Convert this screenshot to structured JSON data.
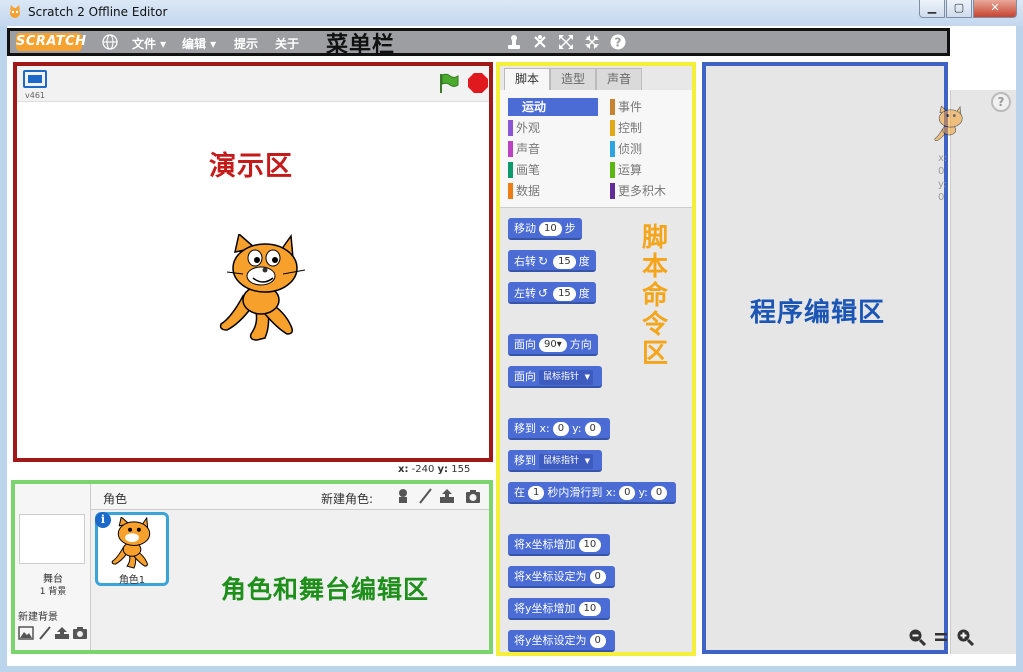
{
  "window": {
    "title": "Scratch 2 Offline Editor",
    "min_label": "▁",
    "max_label": "▢",
    "close_label": "✕"
  },
  "menubar": {
    "logo": "SCRATCH",
    "items": [
      "文件 ▾",
      "编辑 ▾",
      "提示",
      "关于"
    ],
    "annotation": "菜单栏"
  },
  "stage": {
    "version": "v461",
    "annotation": "演示区",
    "coords": {
      "x_label": "x:",
      "x": "-240",
      "y_label": "y:",
      "y": "155"
    }
  },
  "palette": {
    "tabs": [
      "脚本",
      "造型",
      "声音"
    ],
    "categories": [
      {
        "label": "运动",
        "color": "#4a6cd4"
      },
      {
        "label": "外观",
        "color": "#8a55d7"
      },
      {
        "label": "声音",
        "color": "#bb42c3"
      },
      {
        "label": "画笔",
        "color": "#0e9a6c"
      },
      {
        "label": "数据",
        "color": "#ee7d16"
      },
      {
        "label": "事件",
        "color": "#c88330"
      },
      {
        "label": "控制",
        "color": "#e1a91a"
      },
      {
        "label": "侦测",
        "color": "#2ca5e2"
      },
      {
        "label": "运算",
        "color": "#5cb712"
      },
      {
        "label": "更多积木",
        "color": "#632d99"
      }
    ],
    "annotation": "脚本命令区",
    "blocks": {
      "move": {
        "pre": "移动",
        "val": "10",
        "post": "步"
      },
      "turn_right": {
        "pre": "右转",
        "glyph": "↻",
        "val": "15",
        "post": "度"
      },
      "turn_left": {
        "pre": "左转",
        "glyph": "↺",
        "val": "15",
        "post": "度"
      },
      "point_dir": {
        "pre": "面向",
        "val": "90▾",
        "post": "方向"
      },
      "point_towards": {
        "pre": "面向",
        "dd": "鼠标指针"
      },
      "go_xy": {
        "pre": "移到 x:",
        "x": "0",
        "mid": "y:",
        "y": "0"
      },
      "go_to": {
        "pre": "移到",
        "dd": "鼠标指针"
      },
      "glide": {
        "pre": "在",
        "secs": "1",
        "mid": "秒内滑行到 x:",
        "x": "0",
        "mid2": "y:",
        "y": "0"
      },
      "change_x": {
        "pre": "将x坐标增加",
        "val": "10"
      },
      "set_x": {
        "pre": "将x坐标设定为",
        "val": "0"
      },
      "change_y": {
        "pre": "将y坐标增加",
        "val": "10"
      },
      "set_y": {
        "pre": "将y坐标设定为",
        "val": "0"
      }
    }
  },
  "script_area": {
    "annotation": "程序编辑区",
    "x_readout": "x: 0",
    "y_readout": "y: 0",
    "help": "?"
  },
  "sprites": {
    "title": "角色",
    "new_sprite": "新建角色:",
    "stage_name": "舞台",
    "stage_backdrops": "1 背景",
    "new_backdrop": "新建背景",
    "sprite_name": "角色1",
    "info": "i",
    "annotation": "角色和舞台编辑区"
  },
  "colors": {
    "menubar_border": "#111111",
    "stage_border": "#a01818",
    "sprite_border": "#7cd46f",
    "palette_border": "#f4ef3a",
    "script_border": "#3f63c5",
    "motion_block": "#4a6cd4"
  }
}
